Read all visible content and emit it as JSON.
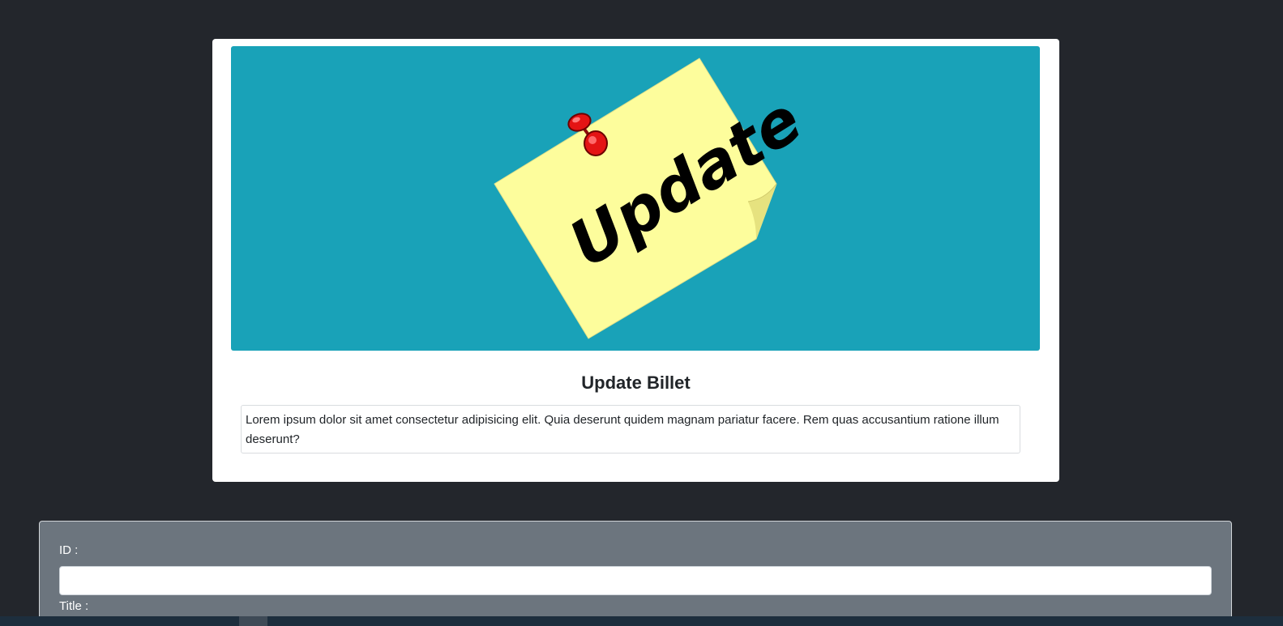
{
  "card": {
    "image_text": "Update",
    "title": "Update Billet",
    "description": "Lorem ipsum dolor sit amet consectetur adipisicing elit. Quia deserunt quidem magnam pariatur facere. Rem quas accusantium ratione illum deserunt?"
  },
  "form": {
    "id_label": "ID :",
    "id_value": "",
    "title_label": "Title :"
  },
  "colors": {
    "page_background": "#23262c",
    "banner_background": "#19a2b8",
    "note_yellow": "#fdfd9c",
    "pin_red": "#e41414",
    "form_panel": "#6c757e"
  }
}
